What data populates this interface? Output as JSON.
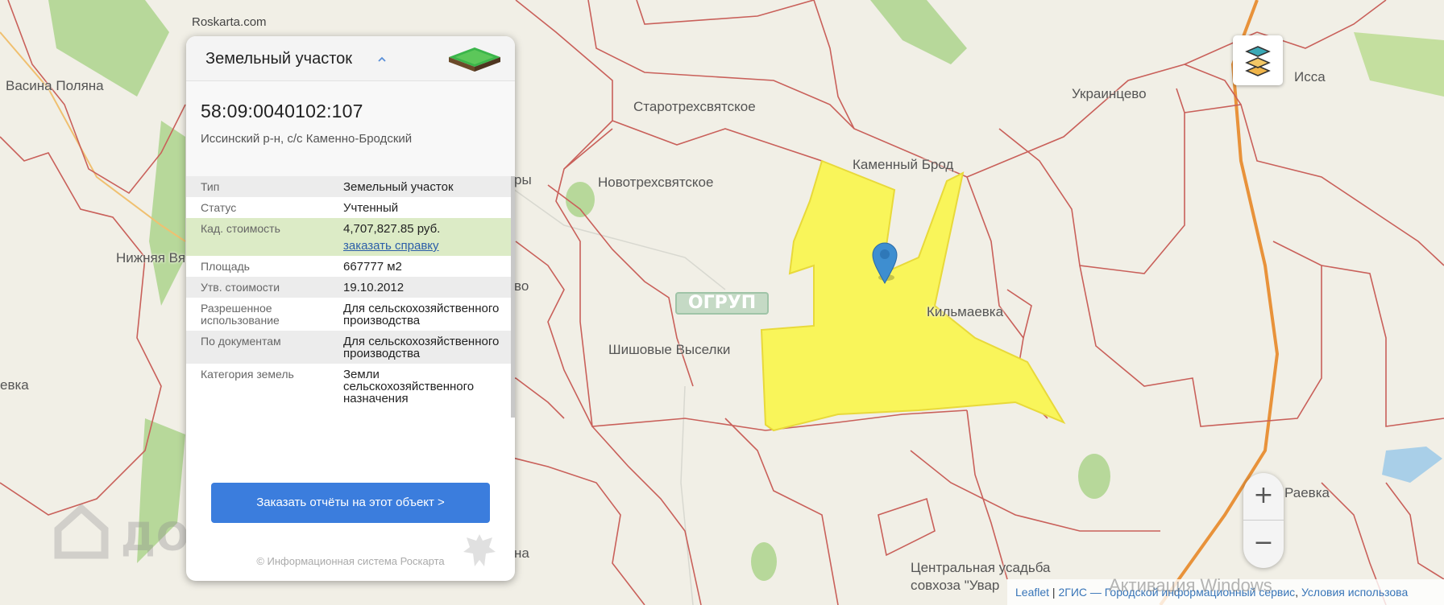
{
  "site": {
    "label": "Roskarta.com"
  },
  "panel": {
    "title": "Земельный участок",
    "icon": "land-plot-icon",
    "cadastral_number": "58:09:0040102:107",
    "address": "Иссинский р-н, с/с Каменно-Бродский",
    "rows": [
      {
        "label": "Тип",
        "value": "Земельный участок"
      },
      {
        "label": "Статус",
        "value": "Учтенный"
      },
      {
        "label": "Кад. стоимость",
        "value": "4,707,827.85 руб.",
        "link": "заказать справку"
      },
      {
        "label": "Площадь",
        "value": "667777 м2"
      },
      {
        "label": "Утв. стоимости",
        "value": "19.10.2012"
      },
      {
        "label": "Разрешенное использование",
        "value": "Для сельскохозяйственного производства"
      },
      {
        "label": "По документам",
        "value": "Для сельскохозяйственного производства"
      },
      {
        "label": "Категория земель",
        "value": "Земли сельскохозяйственного назначения"
      }
    ],
    "order_button": "Заказать отчёты на этот объект >",
    "copyright": "© Информационная система Роскарта"
  },
  "map": {
    "labels": {
      "vasina": "Васина Поляна",
      "starotrekh": "Старотрехсвятское",
      "ukraintsevo": "Украинцево",
      "issa": "Исса",
      "kamenny": "Каменный Брод",
      "novotrekh": "Новотрехсвятское",
      "nizhnyaya": "Нижняя Вя",
      "kilmaevka": "Кильмаевка",
      "shishovye": "Шишовые Выселки",
      "evka": "евка",
      "ry": "ры",
      "vo": "во",
      "na": "на",
      "raevka": "Раевка",
      "central1": "Центральная усадьба",
      "central2": "совхоза \"Увар"
    },
    "watermarks": {
      "domclick": "ДОМКЛИК",
      "ogrup": "ОГРУП"
    },
    "colors": {
      "plot_fill": "#f9f55a",
      "plot_stroke": "#e8d93a",
      "boundary": "#c9605a",
      "background": "#f1efe6",
      "forest": "#b7d89a",
      "road": "#e8923a"
    }
  },
  "controls": {
    "layers_icon": "layers-icon",
    "zoom_in": "+",
    "zoom_out": "−"
  },
  "attribution": {
    "leaflet": "Leaflet",
    "sep1": " | ",
    "dgis": "2ГИС — Городской информационный сервис",
    "sep2": ", ",
    "terms": "Условия использова"
  },
  "os_watermark": "Активация Windows"
}
